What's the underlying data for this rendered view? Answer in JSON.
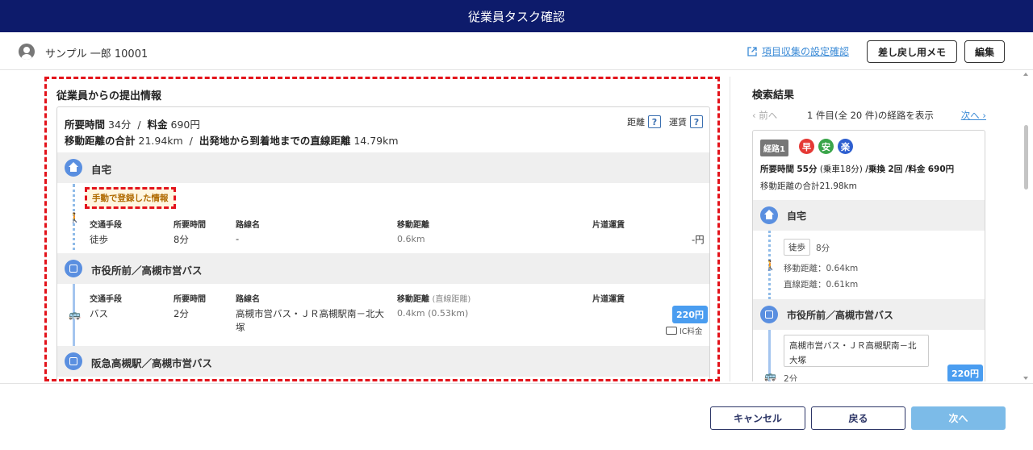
{
  "header": {
    "title": "従業員タスク確認"
  },
  "user": {
    "name": "サンプル 一郎 10001"
  },
  "toolbar": {
    "settings_link": "項目収集の設定確認",
    "memo_label": "差し戻し用メモ",
    "edit_label": "編集"
  },
  "submission": {
    "title": "従業員からの提出情報",
    "summary": {
      "time_label": "所要時間",
      "time_value": "34分",
      "sep1": "/",
      "fare_label": "料金",
      "fare_value": "690円",
      "total_dist_label": "移動距離の合計",
      "total_dist_value": "21.94km",
      "sep2": "/",
      "straight_label": "出発地から到着地までの直線距離",
      "straight_value": "14.79km",
      "help_distance_label": "距離",
      "help_fare_label": "運賃",
      "help_glyph": "?"
    },
    "stations": [
      "自宅",
      "市役所前／高槻市営バス",
      "阪急高槻駅／高槻市営バス"
    ],
    "manual_tag": "手動で登録した情報",
    "headers": {
      "mode": "交通手段",
      "time": "所要時間",
      "line": "路線名",
      "distance": "移動距離",
      "distance_note": "(直線距離)",
      "fare": "片道運賃"
    },
    "segments": [
      {
        "mode": "徒歩",
        "time": "8分",
        "line": "-",
        "distance": "0.6km",
        "fare": "-円"
      },
      {
        "mode": "バス",
        "time": "2分",
        "line": "高槻市営バス・ＪＲ高槻駅南－北大塚",
        "distance": "0.4km (0.53km)",
        "price": "220円",
        "ic_label": "IC料金"
      }
    ]
  },
  "search": {
    "title": "検索結果",
    "prev": "‹ 前へ",
    "count_text": "1 件目(全 20 件)の経路を表示",
    "next": "次へ ›",
    "route": {
      "badge": "経路1",
      "tags": [
        "早",
        "安",
        "楽"
      ],
      "line1_time_label": "所要時間",
      "line1_time": "55分",
      "line1_ride": "(乗車18分)",
      "line1_transfer_label": "/乗換",
      "line1_transfer": "2回",
      "line1_fare_label": "/料金",
      "line1_fare": "690円",
      "line2": "移動距離の合計21.98km",
      "stations": [
        "自宅",
        "市役所前／高槻市営バス"
      ],
      "walk_chip": "徒歩",
      "walk_time": "8分",
      "walk_dist": "移動距離：0.64km",
      "walk_straight": "直線距離：0.61km",
      "bus_line": "高槻市営バス・ＪＲ高槻駅南－北大塚",
      "bus_time": "2分",
      "bus_price": "220円"
    }
  },
  "footer": {
    "cancel": "キャンセル",
    "back": "戻る",
    "next": "次へ"
  },
  "colors": {
    "header_bg": "#0d1b6b",
    "accent_blue": "#4a9df0",
    "highlight_red": "#e3131b",
    "next_button": "#7cbbe8"
  },
  "icons": [
    "user-avatar-icon",
    "external-link-icon",
    "home-icon",
    "bus-stop-icon",
    "walk-icon",
    "bus-icon",
    "ic-card-icon"
  ]
}
